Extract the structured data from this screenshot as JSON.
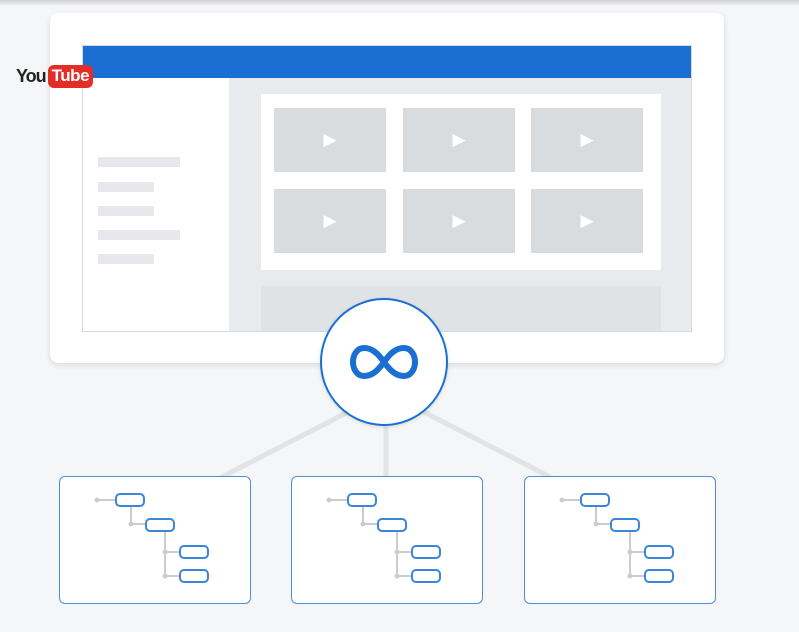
{
  "logo": {
    "you": "You",
    "tube": "Tube"
  },
  "colors": {
    "brand_blue": "#1b6fd2",
    "youtube_red": "#e52d27",
    "tree_node_stroke": "#3a86d8",
    "placeholder_grey": "#d9dcdf",
    "connector_grey": "#e1e4e7"
  },
  "icons": {
    "hub": "infinity-icon",
    "video_thumb": "play-icon",
    "tree": "tree-structure-icon"
  },
  "thumbnails": [
    {
      "icon": "▶"
    },
    {
      "icon": "▶"
    },
    {
      "icon": "▶"
    },
    {
      "icon": "▶"
    },
    {
      "icon": "▶"
    },
    {
      "icon": "▶"
    }
  ]
}
